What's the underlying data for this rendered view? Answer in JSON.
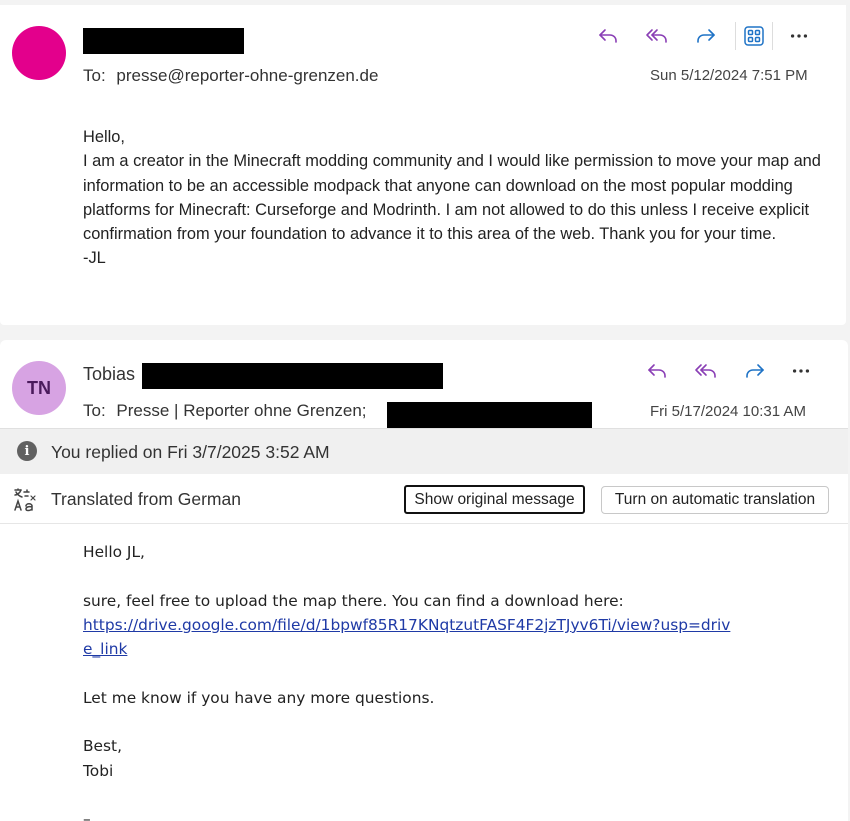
{
  "message1": {
    "avatar_color": "#e3008c",
    "to_label": "To:",
    "to_value": "presse@reporter-ohne-grenzen.de",
    "date": "Sun 5/12/2024 7:51 PM",
    "body": [
      "Hello,",
      "I am a creator in the Minecraft modding community and I would like permission to move your map and information to be an accessible modpack that anyone can download on the most popular modding platforms for Minecraft: Curseforge and Modrinth. I am not allowed to do this unless I receive explicit confirmation from your foundation to advance it to this area of the web. Thank you for your time.",
      "-JL"
    ]
  },
  "message2": {
    "avatar_initials": "TN",
    "avatar_color": "#d7a3e3",
    "sender_first": "Tobias",
    "to_label": "To:",
    "to_value": "Presse | Reporter ohne Grenzen;",
    "date": "Fri 5/17/2024 10:31 AM",
    "replied_notice": "You replied on Fri 3/7/2025 3:52 AM",
    "translated_label": "Translated from German",
    "show_original_label": "Show original message",
    "auto_translate_label": "Turn on automatic translation",
    "greeting": "Hello JL,",
    "line1": "sure, feel free to upload the map there. You can find a download here:",
    "link": "https://drive.google.com/file/d/1bpwf85R17KNqtzutFASF4F2jzTJyv6Ti/view?usp=drive_link",
    "line2": "Let me know if you have any more questions.",
    "sign_best": "Best,",
    "sign_name": "Tobi",
    "trailing": "–"
  },
  "icons": {
    "reply": "reply-icon",
    "reply_all": "reply-all-icon",
    "forward": "forward-icon",
    "apps": "apps-icon",
    "more": "more-icon",
    "info": "info-icon",
    "translate": "translate-icon"
  },
  "colors": {
    "reply_icons": "#8a3fb5",
    "forward_icon": "#1f73c6",
    "apps_icon": "#1f73c6",
    "link": "#1f3aa6"
  }
}
